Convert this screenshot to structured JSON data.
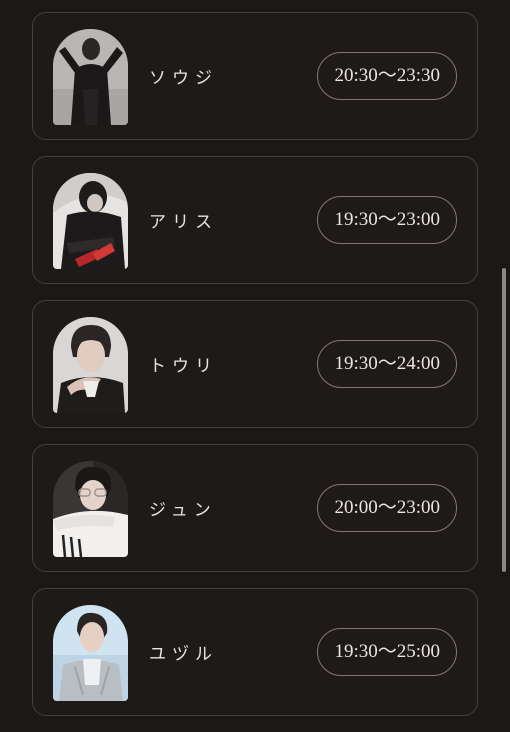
{
  "cast": [
    {
      "name": "ソウジ",
      "time": "20:30〜23:30"
    },
    {
      "name": "アリス",
      "time": "19:30〜23:00"
    },
    {
      "name": "トウリ",
      "time": "19:30〜24:00"
    },
    {
      "name": "ジュン",
      "time": "20:00〜23:00"
    },
    {
      "name": "ユヅル",
      "time": "19:30〜25:00"
    }
  ]
}
